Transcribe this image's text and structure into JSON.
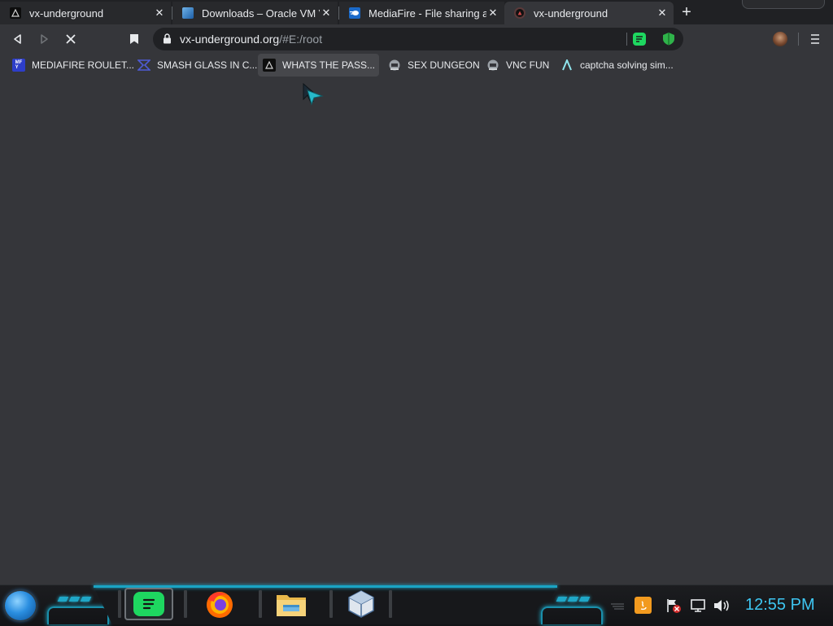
{
  "tabs": [
    {
      "title": "vx-underground",
      "favicon": "vx-underground-icon",
      "state": "inactive",
      "close": "✕"
    },
    {
      "title": "Downloads – Oracle VM VirtualBox",
      "favicon": "virtualbox-icon",
      "state": "inactive",
      "close": "✕"
    },
    {
      "title": "MediaFire - File sharing and storage",
      "favicon": "mediafire-icon",
      "state": "inactive",
      "close": "✕"
    },
    {
      "title": "vx-underground",
      "favicon": "vx-underground-loading-icon",
      "state": "active",
      "close": "✕"
    }
  ],
  "new_tab_label": "+",
  "address_bar": {
    "host": "vx-underground.org",
    "path": "/#E:/root",
    "secure_icon": "lock-icon"
  },
  "toolbar_icons": [
    "back-arrow-icon",
    "forward-arrow-icon",
    "stop-loading-icon",
    "bookmark-icon",
    "green-extension-icon",
    "green-shield-extension-icon",
    "profile-avatar",
    "menu-icon"
  ],
  "bookmarks": [
    {
      "label": "MEDIAFIRE ROULET...",
      "icon": "mediafire-roulette-icon"
    },
    {
      "label": "SMASH GLASS IN C...",
      "icon": "smash-glass-icon"
    },
    {
      "label": "WHATS THE PASS...",
      "icon": "whats-the-pass-icon"
    },
    {
      "label": "SEX DUNGEON",
      "icon": "dungeon-icon"
    },
    {
      "label": "VNC FUN",
      "icon": "vnc-icon"
    },
    {
      "label": "captcha solving sim...",
      "icon": "captcha-icon"
    }
  ],
  "taskbar": {
    "apps": [
      {
        "name": "spotify-app",
        "active": true
      },
      {
        "name": "firefox-app",
        "active": false
      },
      {
        "name": "file-explorer-app",
        "active": false
      },
      {
        "name": "virtualbox-app",
        "active": false
      }
    ],
    "tray_icons": [
      "java-icon",
      "action-center-flag-icon",
      "network-icon",
      "volume-icon"
    ],
    "clock": "12:55 PM"
  },
  "colors": {
    "browser_bg": "#35363a",
    "tabstrip_bg": "#202124",
    "accent_cyan": "#3ec6f2",
    "spotify_green": "#1ed760"
  }
}
